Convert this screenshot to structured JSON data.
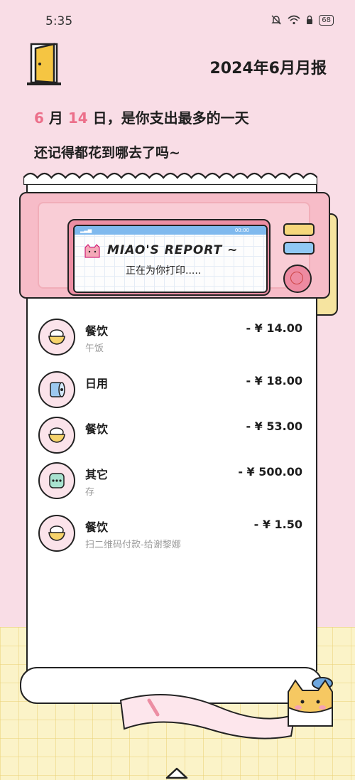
{
  "status_bar": {
    "time": "5:35",
    "battery": "68"
  },
  "header": {
    "title": "2024年6月月报",
    "headline_month": "6",
    "headline_month_unit": "月",
    "headline_day": "14",
    "headline_rest": "日，是你支出最多的一天",
    "subheadline": "还记得都花到哪去了吗~"
  },
  "printer": {
    "brand": "MIAO'S REPORT ~",
    "status": "正在为你打印.....",
    "screen_time": "00:00"
  },
  "transactions": [
    {
      "category": "餐饮",
      "note": "午饭",
      "amount": "- ¥ 14.00",
      "icon": "rice-bowl-icon"
    },
    {
      "category": "日用",
      "note": "",
      "amount": "- ¥ 18.00",
      "icon": "toilet-paper-icon"
    },
    {
      "category": "餐饮",
      "note": "",
      "amount": "- ¥ 53.00",
      "icon": "rice-bowl-icon"
    },
    {
      "category": "其它",
      "note": "存",
      "amount": "- ¥ 500.00",
      "icon": "other-dots-icon"
    },
    {
      "category": "餐饮",
      "note": "扫二维码付款-给谢黎娜",
      "amount": "- ¥ 1.50",
      "icon": "rice-bowl-icon"
    }
  ],
  "colors": {
    "accent_pink": "#ec6f8a",
    "background": "#f9dde6",
    "printer": "#f7bcc8"
  }
}
